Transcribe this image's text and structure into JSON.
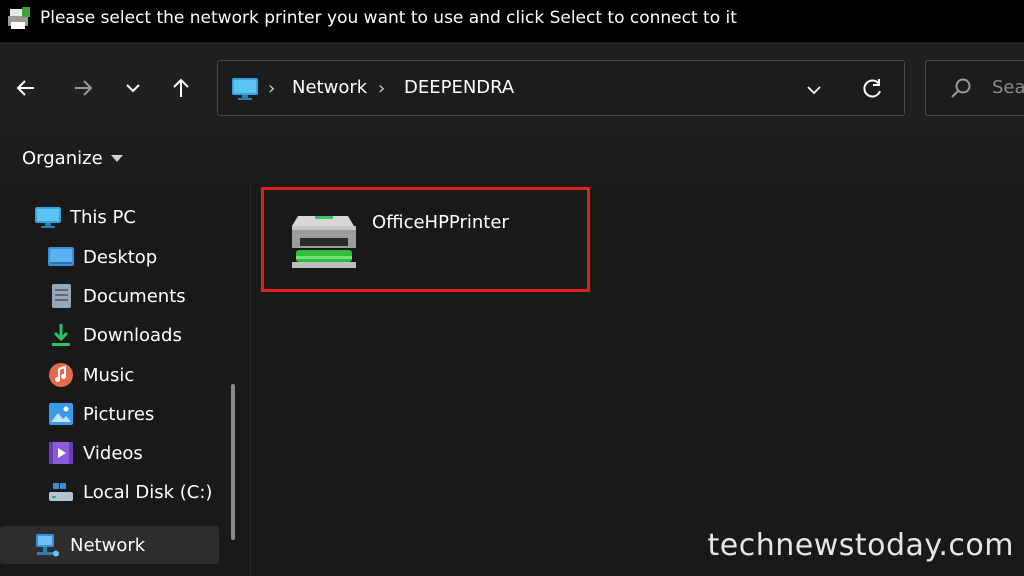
{
  "dialog": {
    "title": "Please select the network printer you want to use and click Select to connect to it"
  },
  "navigation": {
    "back_icon": "arrow-left-icon",
    "forward_icon": "arrow-right-icon",
    "recent_icon": "chevron-down-icon",
    "up_icon": "arrow-up-icon"
  },
  "address_bar": {
    "crumbs": [
      "Network",
      "DEEPENDRA"
    ],
    "separator": "›"
  },
  "search": {
    "placeholder": "Sear"
  },
  "toolbar": {
    "organize_label": "Organize"
  },
  "sidebar": {
    "items": [
      {
        "label": "This PC",
        "icon": "this-pc-icon"
      },
      {
        "label": "Desktop",
        "icon": "desktop-icon"
      },
      {
        "label": "Documents",
        "icon": "documents-icon"
      },
      {
        "label": "Downloads",
        "icon": "downloads-icon"
      },
      {
        "label": "Music",
        "icon": "music-icon"
      },
      {
        "label": "Pictures",
        "icon": "pictures-icon"
      },
      {
        "label": "Videos",
        "icon": "videos-icon"
      },
      {
        "label": "Local Disk (C:)",
        "icon": "local-disk-icon"
      },
      {
        "label": "Network",
        "icon": "network-icon",
        "selected": true
      }
    ]
  },
  "content": {
    "items": [
      {
        "label": "OfficeHPPrinter",
        "icon": "printer-icon",
        "highlight_color": "#e01e1e"
      }
    ]
  },
  "watermark": "technewstoday.com",
  "colors": {
    "background": "#191919",
    "titlebar": "#000000",
    "highlight_box": "#e01e1e",
    "accent_green": "#2fbf3a"
  }
}
